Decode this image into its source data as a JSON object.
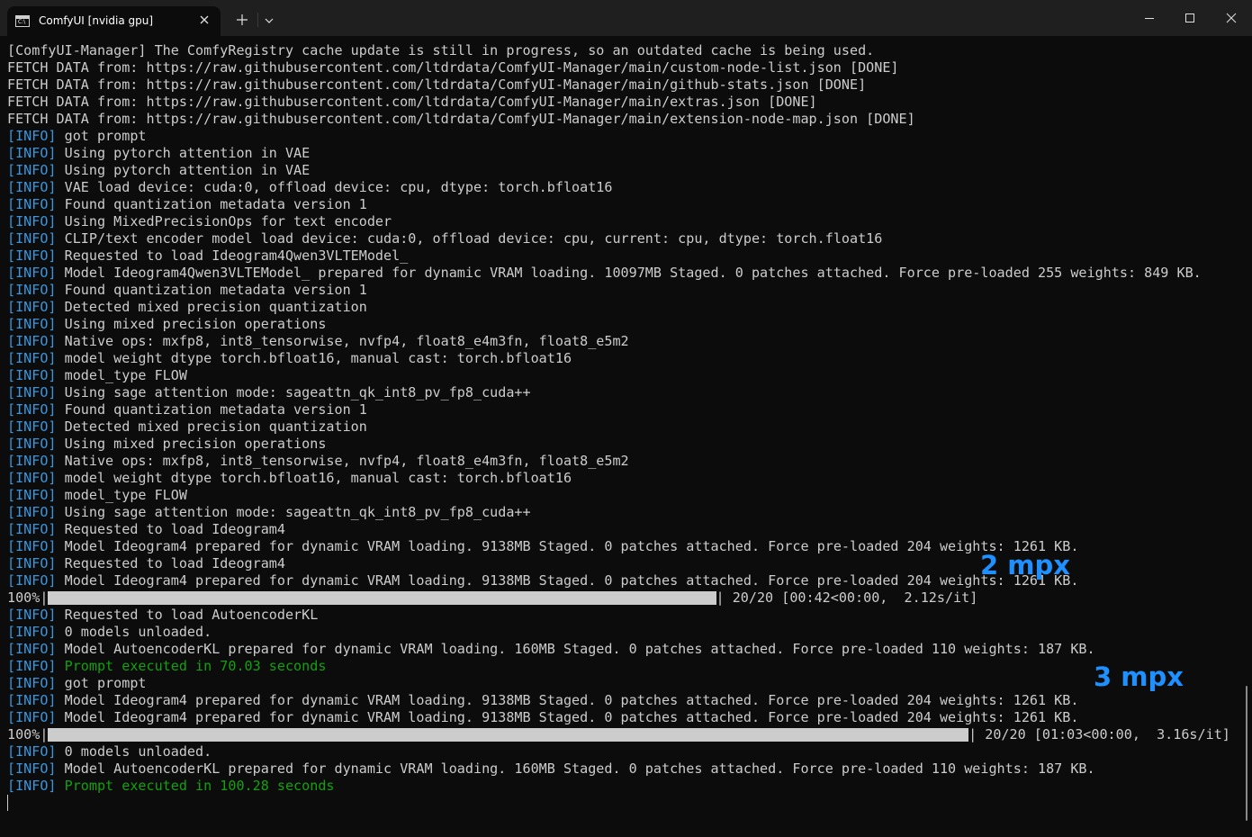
{
  "window": {
    "tab_title": "ComfyUI [nvidia gpu]",
    "tab_icon": "terminal-icon",
    "tab_icon_text": "C:\\"
  },
  "terminal": {
    "lines": [
      {
        "parts": [
          {
            "t": "[ComfyUI-Manager] The ComfyRegistry cache update is still in progress, so an outdated cache is being used."
          }
        ]
      },
      {
        "parts": [
          {
            "t": "FETCH DATA from: https://raw.githubusercontent.com/ltdrdata/ComfyUI-Manager/main/custom-node-list.json [DONE]"
          }
        ]
      },
      {
        "parts": [
          {
            "t": "FETCH DATA from: https://raw.githubusercontent.com/ltdrdata/ComfyUI-Manager/main/github-stats.json [DONE]"
          }
        ]
      },
      {
        "parts": [
          {
            "t": "FETCH DATA from: https://raw.githubusercontent.com/ltdrdata/ComfyUI-Manager/main/extras.json [DONE]"
          }
        ]
      },
      {
        "parts": [
          {
            "t": "FETCH DATA from: https://raw.githubusercontent.com/ltdrdata/ComfyUI-Manager/main/extension-node-map.json [DONE]"
          }
        ]
      },
      {
        "parts": [
          {
            "t": "[INFO]",
            "c": "tag"
          },
          {
            "t": " got prompt"
          }
        ]
      },
      {
        "parts": [
          {
            "t": "[INFO]",
            "c": "tag"
          },
          {
            "t": " Using pytorch attention in VAE"
          }
        ]
      },
      {
        "parts": [
          {
            "t": "[INFO]",
            "c": "tag"
          },
          {
            "t": " Using pytorch attention in VAE"
          }
        ]
      },
      {
        "parts": [
          {
            "t": "[INFO]",
            "c": "tag"
          },
          {
            "t": " VAE load device: cuda:0, offload device: cpu, dtype: torch.bfloat16"
          }
        ]
      },
      {
        "parts": [
          {
            "t": "[INFO]",
            "c": "tag"
          },
          {
            "t": " Found quantization metadata version 1"
          }
        ]
      },
      {
        "parts": [
          {
            "t": "[INFO]",
            "c": "tag"
          },
          {
            "t": " Using MixedPrecisionOps for text encoder"
          }
        ]
      },
      {
        "parts": [
          {
            "t": "[INFO]",
            "c": "tag"
          },
          {
            "t": " CLIP/text encoder model load device: cuda:0, offload device: cpu, current: cpu, dtype: torch.float16"
          }
        ]
      },
      {
        "parts": [
          {
            "t": "[INFO]",
            "c": "tag"
          },
          {
            "t": " Requested to load Ideogram4Qwen3VLTEModel_"
          }
        ]
      },
      {
        "parts": [
          {
            "t": "[INFO]",
            "c": "tag"
          },
          {
            "t": " Model Ideogram4Qwen3VLTEModel_ prepared for dynamic VRAM loading. 10097MB Staged. 0 patches attached. Force pre-loaded 255 weights: 849 KB."
          }
        ]
      },
      {
        "parts": [
          {
            "t": "[INFO]",
            "c": "tag"
          },
          {
            "t": " Found quantization metadata version 1"
          }
        ]
      },
      {
        "parts": [
          {
            "t": "[INFO]",
            "c": "tag"
          },
          {
            "t": " Detected mixed precision quantization"
          }
        ]
      },
      {
        "parts": [
          {
            "t": "[INFO]",
            "c": "tag"
          },
          {
            "t": " Using mixed precision operations"
          }
        ]
      },
      {
        "parts": [
          {
            "t": "[INFO]",
            "c": "tag"
          },
          {
            "t": " Native ops: mxfp8, int8_tensorwise, nvfp4, float8_e4m3fn, float8_e5m2"
          }
        ]
      },
      {
        "parts": [
          {
            "t": "[INFO]",
            "c": "tag"
          },
          {
            "t": " model weight dtype torch.bfloat16, manual cast: torch.bfloat16"
          }
        ]
      },
      {
        "parts": [
          {
            "t": "[INFO]",
            "c": "tag"
          },
          {
            "t": " model_type FLOW"
          }
        ]
      },
      {
        "parts": [
          {
            "t": "[INFO]",
            "c": "tag"
          },
          {
            "t": " Using sage attention mode: sageattn_qk_int8_pv_fp8_cuda++"
          }
        ]
      },
      {
        "parts": [
          {
            "t": "[INFO]",
            "c": "tag"
          },
          {
            "t": " Found quantization metadata version 1"
          }
        ]
      },
      {
        "parts": [
          {
            "t": "[INFO]",
            "c": "tag"
          },
          {
            "t": " Detected mixed precision quantization"
          }
        ]
      },
      {
        "parts": [
          {
            "t": "[INFO]",
            "c": "tag"
          },
          {
            "t": " Using mixed precision operations"
          }
        ]
      },
      {
        "parts": [
          {
            "t": "[INFO]",
            "c": "tag"
          },
          {
            "t": " Native ops: mxfp8, int8_tensorwise, nvfp4, float8_e4m3fn, float8_e5m2"
          }
        ]
      },
      {
        "parts": [
          {
            "t": "[INFO]",
            "c": "tag"
          },
          {
            "t": " model weight dtype torch.bfloat16, manual cast: torch.bfloat16"
          }
        ]
      },
      {
        "parts": [
          {
            "t": "[INFO]",
            "c": "tag"
          },
          {
            "t": " model_type FLOW"
          }
        ]
      },
      {
        "parts": [
          {
            "t": "[INFO]",
            "c": "tag"
          },
          {
            "t": " Using sage attention mode: sageattn_qk_int8_pv_fp8_cuda++"
          }
        ]
      },
      {
        "parts": [
          {
            "t": "[INFO]",
            "c": "tag"
          },
          {
            "t": " Requested to load Ideogram4"
          }
        ]
      },
      {
        "parts": [
          {
            "t": "[INFO]",
            "c": "tag"
          },
          {
            "t": " Model Ideogram4 prepared for dynamic VRAM loading. 9138MB Staged. 0 patches attached. Force pre-loaded 204 weights: 1261 KB."
          }
        ]
      },
      {
        "parts": [
          {
            "t": "[INFO]",
            "c": "tag"
          },
          {
            "t": " Requested to load Ideogram4"
          }
        ]
      },
      {
        "parts": [
          {
            "t": "[INFO]",
            "c": "tag"
          },
          {
            "t": " Model Ideogram4 prepared for dynamic VRAM loading. 9138MB Staged. 0 patches attached. Force pre-loaded 204 weights: 1261 KB."
          }
        ]
      },
      {
        "progress": {
          "prefix": "100%|",
          "fraction": 1.0,
          "bar_chars": 82,
          "suffix": "| 20/20 [00:42<00:00,  2.12s/it]"
        }
      },
      {
        "parts": [
          {
            "t": "[INFO]",
            "c": "tag"
          },
          {
            "t": " Requested to load AutoencoderKL"
          }
        ]
      },
      {
        "parts": [
          {
            "t": "[INFO]",
            "c": "tag"
          },
          {
            "t": " 0 models unloaded."
          }
        ]
      },
      {
        "parts": [
          {
            "t": "[INFO]",
            "c": "tag"
          },
          {
            "t": " Model AutoencoderKL prepared for dynamic VRAM loading. 160MB Staged. 0 patches attached. Force pre-loaded 110 weights: 187 KB."
          }
        ]
      },
      {
        "parts": [
          {
            "t": "[INFO]",
            "c": "tag"
          },
          {
            "t": " Prompt executed in 70.03 seconds",
            "c": "ok"
          }
        ]
      },
      {
        "parts": [
          {
            "t": "[INFO]",
            "c": "tag"
          },
          {
            "t": " got prompt"
          }
        ]
      },
      {
        "parts": [
          {
            "t": "[INFO]",
            "c": "tag"
          },
          {
            "t": " Model Ideogram4 prepared for dynamic VRAM loading. 9138MB Staged. 0 patches attached. Force pre-loaded 204 weights: 1261 KB."
          }
        ]
      },
      {
        "parts": [
          {
            "t": "[INFO]",
            "c": "tag"
          },
          {
            "t": " Model Ideogram4 prepared for dynamic VRAM loading. 9138MB Staged. 0 patches attached. Force pre-loaded 204 weights: 1261 KB."
          }
        ]
      },
      {
        "progress": {
          "prefix": "100%|",
          "fraction": 1.0,
          "bar_chars": 113,
          "suffix": "| 20/20 [01:03<00:00,  3.16s/it]"
        }
      },
      {
        "parts": [
          {
            "t": "[INFO]",
            "c": "tag"
          },
          {
            "t": " 0 models unloaded."
          }
        ]
      },
      {
        "parts": [
          {
            "t": "[INFO]",
            "c": "tag"
          },
          {
            "t": " Model AutoencoderKL prepared for dynamic VRAM loading. 160MB Staged. 0 patches attached. Force pre-loaded 110 weights: 187 KB."
          }
        ]
      },
      {
        "parts": [
          {
            "t": "[INFO]",
            "c": "tag"
          },
          {
            "t": " Prompt executed in 100.28 seconds",
            "c": "ok"
          }
        ]
      }
    ]
  },
  "annotations": {
    "first": "2 mpx",
    "second": "3 mpx"
  },
  "colors": {
    "background": "#0c0c0c",
    "titlebar": "#1f1f1f",
    "text": "#cccccc",
    "info_tag": "#3a96dd",
    "success": "#13a10e",
    "annotation": "#1e90ff",
    "progress_fill": "#cccccc"
  }
}
